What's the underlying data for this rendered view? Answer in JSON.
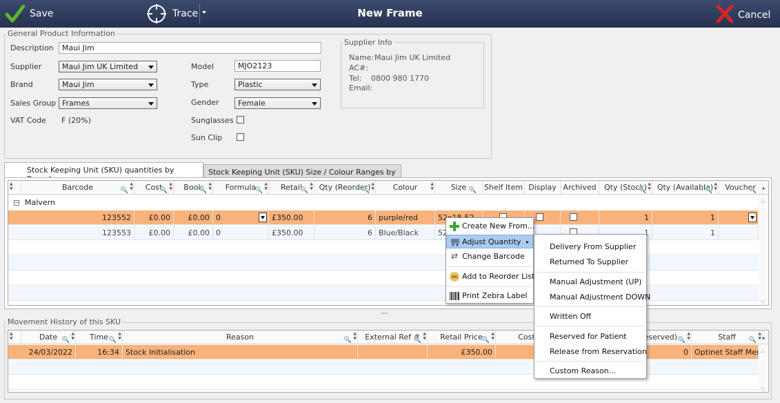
{
  "titlebar": {
    "save_label": "Save",
    "trace_label": "Trace",
    "title": "New Frame",
    "cancel_label": "Cancel"
  },
  "general": {
    "legend": "General Product Information",
    "description_label": "Description",
    "description_value": "Maui Jim",
    "supplier_label": "Supplier",
    "supplier_value": "Maui Jim UK Limited",
    "brand_label": "Brand",
    "brand_value": "Maui Jim",
    "sales_group_label": "Sales Group",
    "sales_group_value": "Frames",
    "vat_label": "VAT Code",
    "vat_value": "F (20%)",
    "model_label": "Model",
    "model_value": "MJO2123",
    "type_label": "Type",
    "type_value": "Plastic",
    "gender_label": "Gender",
    "gender_value": "Female",
    "sunglasses_label": "Sunglasses",
    "sunclip_label": "Sun Clip"
  },
  "supplier_info": {
    "legend": "Supplier Info",
    "name_label": "Name:",
    "name_value": "Maui Jim UK Limited",
    "ac_label": "AC#:",
    "tel_label": "Tel:",
    "tel_value": "0800 980 1770",
    "email_label": "Email:"
  },
  "tabs": [
    "Stock Keeping Unit (SKU) quantities by Branch",
    "Stock Keeping Unit (SKU) Size / Colour Ranges by Branch"
  ],
  "sku_grid": {
    "columns": [
      "Barcode",
      "Cost",
      "Book",
      "Formula",
      "Retail",
      "Qty (Reorder)",
      "Colour",
      "Size",
      "Shelf Item",
      "Display",
      "Archived",
      "Qty (Stock)",
      "Qty (Available)",
      "Voucher"
    ],
    "group_label": "Malvern",
    "rows": [
      {
        "barcode": "123552",
        "cost": "£0.00",
        "book": "£0.00",
        "formula": "0",
        "retail": "£350.00",
        "reorder": "6",
        "colour": "purple/red",
        "size": "52x18-52",
        "stock": "1",
        "available": "1"
      },
      {
        "barcode": "123553",
        "cost": "£0.00",
        "book": "£0.00",
        "formula": "0",
        "retail": "£350.00",
        "reorder": "6",
        "colour": "Blue/Black",
        "size": "52x1",
        "stock": "1",
        "available": "1"
      }
    ]
  },
  "splitter": "·····",
  "movement": {
    "legend": "Movement History of this SKU",
    "columns": [
      "Date",
      "Time",
      "Reason",
      "External Ref #",
      "Retail Price",
      "Cost P",
      "(Reserved)",
      "Staff"
    ],
    "rows": [
      {
        "date": "24/03/2022",
        "time": "16:34",
        "reason": "Stock Initialisation",
        "retail": "£350.00",
        "reserved": "0",
        "staff": "Optinet Staff Memb"
      }
    ]
  },
  "context_menu": [
    "Create New From...",
    "Adjust Quantity",
    "Change Barcode",
    "Add to Reorder List",
    "Print Zebra Label"
  ],
  "submenu": [
    "Delivery From Supplier",
    "Returned To Supplier",
    "Manual Adjustment (UP)",
    "Manual Adjustment DOWN",
    "Written Off",
    "Reserved for Patient",
    "Release from Reservation",
    "Custom Reason..."
  ],
  "colors": {
    "titlebar": "#2f3b5c",
    "selected_row": "#f9b27a",
    "menu_highlight": "#a9cdf0",
    "save_check": "#5cb82e",
    "cancel_x": "#d9232a"
  }
}
